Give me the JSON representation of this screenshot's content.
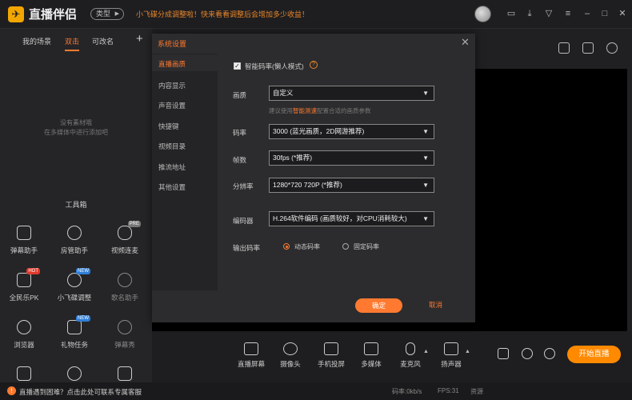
{
  "app": {
    "name": "直播伴侣",
    "type_button": "类型",
    "notice": "小飞碟分成调整啦！快来看看调整后会增加多少收益！"
  },
  "scene_tabs": [
    "我的场景",
    "双击",
    "可改名"
  ],
  "empty_tip": [
    "没有素材哦",
    "在多媒体中进行添加吧"
  ],
  "toolbox": {
    "title": "工具箱",
    "items": [
      {
        "label": "弹幕助手",
        "icon": "chat-icon"
      },
      {
        "label": "房管助手",
        "icon": "admin-icon"
      },
      {
        "label": "视频连麦",
        "icon": "mic-link-icon",
        "badge": "PRE"
      },
      {
        "label": "全民乐PK",
        "icon": "pk-icon",
        "badge": "HOT"
      },
      {
        "label": "小飞碟调整",
        "icon": "ufo-icon",
        "badge": "NEW"
      },
      {
        "label": "歌名助手",
        "icon": "download-icon"
      },
      {
        "label": "浏览器",
        "icon": "compass-icon"
      },
      {
        "label": "礼物任务",
        "icon": "gift-icon",
        "badge": "NEW"
      },
      {
        "label": "弹幕秀",
        "icon": "download-icon"
      }
    ]
  },
  "dialog": {
    "title": "系统设置",
    "nav": [
      "直播画质",
      "内容显示",
      "声音设置",
      "快捷键",
      "视频目录",
      "推流地址",
      "其他设置"
    ],
    "smart_bitrate": "智能码率(懒人模式)",
    "quality_label": "画质",
    "quality_value": "自定义",
    "quality_tip_pre": "建议使用",
    "quality_tip_link": "智能测速",
    "quality_tip_post": "配置合适的画质参数",
    "bitrate_label": "码率",
    "bitrate_value": "3000 (蓝光画质，2D网游推荐)",
    "fps_label": "帧数",
    "fps_value": "30fps (*推荐)",
    "resolution_label": "分辨率",
    "resolution_value": "1280*720 720P (*推荐)",
    "encoder_label": "编码器",
    "encoder_value": "H.264软件编码 (画质较好，对CPU消耗较大)",
    "output_label": "输出码率",
    "output_options": [
      "动态码率",
      "固定码率"
    ],
    "ok": "确定",
    "cancel": "取消"
  },
  "bottom_tools": [
    "直播屏幕",
    "摄像头",
    "手机投屏",
    "多媒体",
    "麦克风",
    "扬声器"
  ],
  "start_button": "开始直播",
  "status": {
    "help": "直播遇到困难？点击此处可联系专属客服",
    "bitrate": "码率:0kb/s",
    "fps": "FPS:31",
    "cpu": "资源"
  }
}
